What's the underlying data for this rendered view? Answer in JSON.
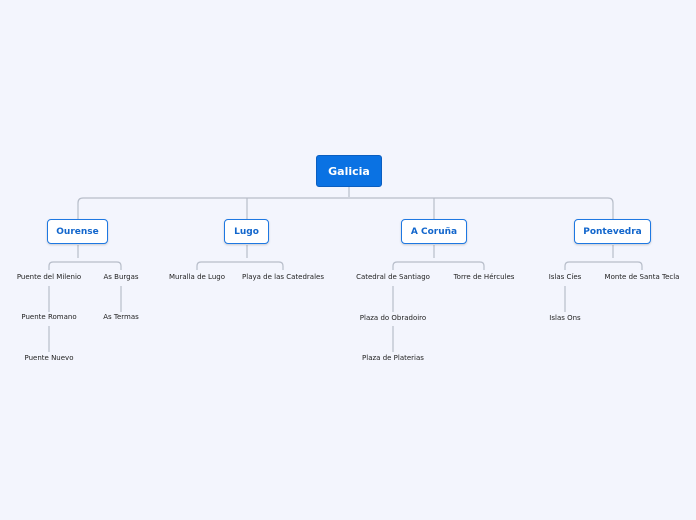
{
  "root": "Galicia",
  "branches": [
    {
      "label": "Ourense",
      "topics": [
        "Puente del Milenio",
        "As Burgas",
        "Puente Romano",
        "As Termas",
        "Puente Nuevo"
      ]
    },
    {
      "label": "Lugo",
      "topics": [
        "Muralla de Lugo",
        "Playa de las Catedrales"
      ]
    },
    {
      "label": "A Coruña",
      "topics": [
        "Catedral de Santiago",
        "Torre de Hércules",
        "Plaza do Obradoiro",
        "Plaza de Platerias"
      ]
    },
    {
      "label": "Pontevedra",
      "topics": [
        "Islas Cíes",
        "Monte de Santa Tecla",
        "Islas Ons"
      ]
    }
  ]
}
